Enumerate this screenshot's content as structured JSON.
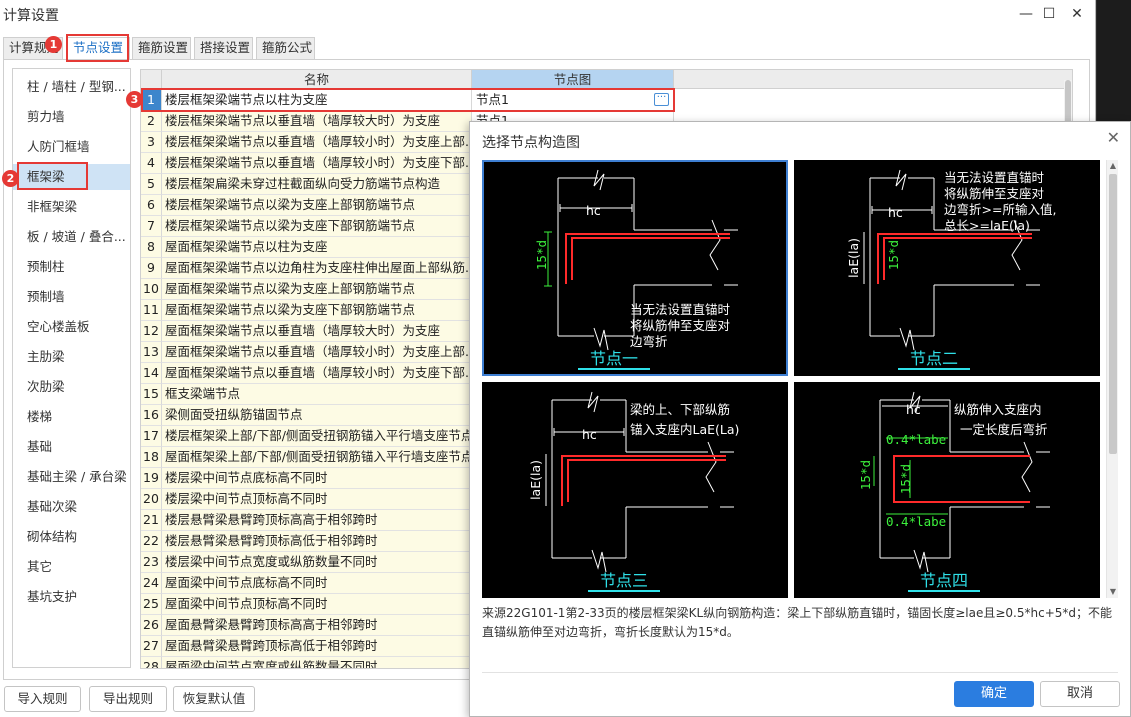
{
  "window": {
    "title": "计算设置",
    "minimize_glyph": "—",
    "maximize_glyph": "☐",
    "close_glyph": "✕"
  },
  "tabs": [
    {
      "label": "计算规则"
    },
    {
      "label": "节点设置"
    },
    {
      "label": "箍筋设置"
    },
    {
      "label": "搭接设置"
    },
    {
      "label": "箍筋公式"
    }
  ],
  "sidebar": {
    "items": [
      {
        "label": "柱 / 墙柱 / 型钢..."
      },
      {
        "label": "剪力墙"
      },
      {
        "label": "人防门框墙"
      },
      {
        "label": "框架梁"
      },
      {
        "label": "非框架梁"
      },
      {
        "label": "板 / 坡道 / 叠合..."
      },
      {
        "label": "预制柱"
      },
      {
        "label": "预制墙"
      },
      {
        "label": "空心楼盖板"
      },
      {
        "label": "主肋梁"
      },
      {
        "label": "次肋梁"
      },
      {
        "label": "楼梯"
      },
      {
        "label": "基础"
      },
      {
        "label": "基础主梁 / 承台梁"
      },
      {
        "label": "基础次梁"
      },
      {
        "label": "砌体结构"
      },
      {
        "label": "其它"
      },
      {
        "label": "基坑支护"
      }
    ]
  },
  "table": {
    "headers": {
      "name": "名称",
      "node": "节点图"
    },
    "rows": [
      {
        "num": "1",
        "name": "楼层框架梁端节点以柱为支座",
        "node": "节点1"
      },
      {
        "num": "2",
        "name": "楼层框架梁端节点以垂直墙（墙厚较大时）为支座",
        "node": "节点1"
      },
      {
        "num": "3",
        "name": "楼层框架梁端节点以垂直墙（墙厚较小时）为支座上部...",
        "node": ""
      },
      {
        "num": "4",
        "name": "楼层框架梁端节点以垂直墙（墙厚较小时）为支座下部...",
        "node": ""
      },
      {
        "num": "5",
        "name": "楼层框架扁梁未穿过柱截面纵向受力筋端节点构造",
        "node": ""
      },
      {
        "num": "6",
        "name": "楼层框架梁端节点以梁为支座上部钢筋端节点",
        "node": ""
      },
      {
        "num": "7",
        "name": "楼层框架梁端节点以梁为支座下部钢筋端节点",
        "node": ""
      },
      {
        "num": "8",
        "name": "屋面框架梁端节点以柱为支座",
        "node": ""
      },
      {
        "num": "9",
        "name": "屋面框架梁端节点以边角柱为支座柱伸出屋面上部纵筋...",
        "node": ""
      },
      {
        "num": "10",
        "name": "屋面框架梁端节点以梁为支座上部钢筋端节点",
        "node": ""
      },
      {
        "num": "11",
        "name": "屋面框架梁端节点以梁为支座下部钢筋端节点",
        "node": ""
      },
      {
        "num": "12",
        "name": "屋面框架梁端节点以垂直墙（墙厚较大时）为支座",
        "node": ""
      },
      {
        "num": "13",
        "name": "屋面框架梁端节点以垂直墙（墙厚较小时）为支座上部...",
        "node": ""
      },
      {
        "num": "14",
        "name": "屋面框架梁端节点以垂直墙（墙厚较小时）为支座下部...",
        "node": ""
      },
      {
        "num": "15",
        "name": "框支梁端节点",
        "node": ""
      },
      {
        "num": "16",
        "name": "梁侧面受扭纵筋锚固节点",
        "node": ""
      },
      {
        "num": "17",
        "name": "楼层框架梁上部/下部/侧面受扭钢筋锚入平行墙支座节点",
        "node": ""
      },
      {
        "num": "18",
        "name": "屋面框架梁上部/下部/侧面受扭钢筋锚入平行墙支座节点",
        "node": ""
      },
      {
        "num": "19",
        "name": "楼层梁中间节点底标高不同时",
        "node": ""
      },
      {
        "num": "20",
        "name": "楼层梁中间节点顶标高不同时",
        "node": ""
      },
      {
        "num": "21",
        "name": "楼层悬臂梁悬臂跨顶标高高于相邻跨时",
        "node": ""
      },
      {
        "num": "22",
        "name": "楼层悬臂梁悬臂跨顶标高低于相邻跨时",
        "node": ""
      },
      {
        "num": "23",
        "name": "楼层梁中间节点宽度或纵筋数量不同时",
        "node": ""
      },
      {
        "num": "24",
        "name": "屋面梁中间节点底标高不同时",
        "node": ""
      },
      {
        "num": "25",
        "name": "屋面梁中间节点顶标高不同时",
        "node": ""
      },
      {
        "num": "26",
        "name": "屋面悬臂梁悬臂跨顶标高高于相邻跨时",
        "node": ""
      },
      {
        "num": "27",
        "name": "屋面悬臂梁悬臂跨顶标高低于相邻跨时",
        "node": ""
      },
      {
        "num": "28",
        "name": "屋面梁中间节点宽度或纵筋数量不同时",
        "node": ""
      }
    ],
    "dots_glyph": "···"
  },
  "buttons": {
    "import": "导入规则",
    "export": "导出规则",
    "restore": "恢复默认值"
  },
  "annotations": {
    "badge1": "1",
    "badge2": "2",
    "badge3": "3"
  },
  "dialog": {
    "title": "选择节点构造图",
    "close_glyph": "✕",
    "panels": [
      {
        "label": "节点一",
        "hc": "hc",
        "dim": "15*d",
        "note": [
          "当无法设置直锚时",
          "将纵筋伸至支座对",
          "边弯折"
        ]
      },
      {
        "label": "节点二",
        "hc": "hc",
        "dim": "15*d",
        "lae": "laE(la)",
        "note": [
          "当无法设置直锚时",
          "将纵筋伸至支座对",
          "边弯折>=所输入值,",
          "总长>=laE(la)"
        ]
      },
      {
        "label": "节点三",
        "hc": "hc",
        "lae": "laE(la)",
        "note": [
          "梁的上、下部纵筋",
          "锚入支座内LaE(La)"
        ]
      },
      {
        "label": "节点四",
        "hc": "hc",
        "dim": "15*d",
        "labe_top": "0.4*labe",
        "labe_bottom": "0.4*labe",
        "note": [
          "纵筋伸入支座内",
          "一定长度后弯折"
        ]
      }
    ],
    "description": "来源22G101-1第2-33页的楼层框架梁KL纵向钢筋构造：梁上下部纵筋直锚时，锚固长度≥lae且≥0.5*hc+5*d；不能直锚纵筋伸至对边弯折，弯折长度默认为15*d。",
    "ok": "确定",
    "cancel": "取消"
  },
  "colors": {
    "accent": "#2b7de0",
    "annotation_red": "#e53935",
    "rebar_red": "#ff2a2a",
    "label_cyan": "#2fe0e8",
    "dim_green": "#3cf03c"
  }
}
